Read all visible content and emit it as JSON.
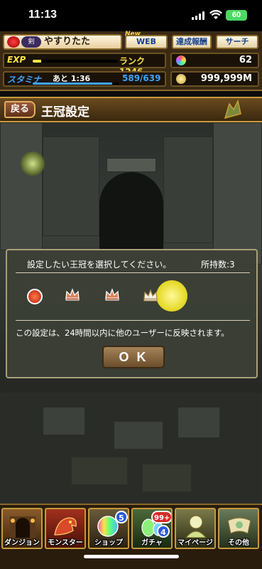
{
  "status_bar": {
    "time": "11:13",
    "battery": "60"
  },
  "header": {
    "player_name": "やすりたた",
    "title_badge": "剣",
    "web_new_tag": "New",
    "web_button": "WEB",
    "achievements_button": "達成報酬",
    "search_button": "サーチ",
    "exp_label": "EXP",
    "rank_text": "ランク1246",
    "exp_progress": 0.1,
    "stamina_label": "スタミナ",
    "stamina_timer": "あと 1:36",
    "stamina_value": "589/639",
    "stamina_progress": 0.92,
    "magic_stones": "62",
    "coins": "999,999M"
  },
  "page": {
    "back_label": "戻る",
    "title": "王冠設定"
  },
  "dialog": {
    "prompt": "設定したい王冠を選択してください。",
    "owned_count": "所持数:3",
    "crowns": [
      {
        "name": "none",
        "icon": "red-orb-icon",
        "selected": false
      },
      {
        "name": "crown-1",
        "icon": "bronze-crown-icon",
        "selected": false
      },
      {
        "name": "crown-2",
        "icon": "bronze-crown-icon",
        "selected": false
      },
      {
        "name": "crown-3",
        "icon": "silver-crown-icon",
        "selected": true
      }
    ],
    "notice": "この設定は、24時間以内に他のユーザーに反映されます。",
    "ok_label": "O K"
  },
  "nav": {
    "items": [
      {
        "label": "ダンジョン",
        "icon": "dungeon-gate-icon"
      },
      {
        "label": "モンスター",
        "icon": "dragon-icon"
      },
      {
        "label": "ショップ",
        "icon": "rainbow-stone-icon",
        "badge": "5"
      },
      {
        "label": "ガチャ",
        "icon": "egg-icon",
        "badge_top": "99+",
        "badge_bottom": "4"
      },
      {
        "label": "マイページ",
        "icon": "avatar-icon"
      },
      {
        "label": "その他",
        "icon": "scroll-icon"
      }
    ]
  },
  "colors": {
    "accent_gold": "#c89a3c",
    "selected_glow": "#e7dc2e",
    "stamina_blue": "#3fa5ff",
    "exp_yellow": "#ffe24a"
  }
}
